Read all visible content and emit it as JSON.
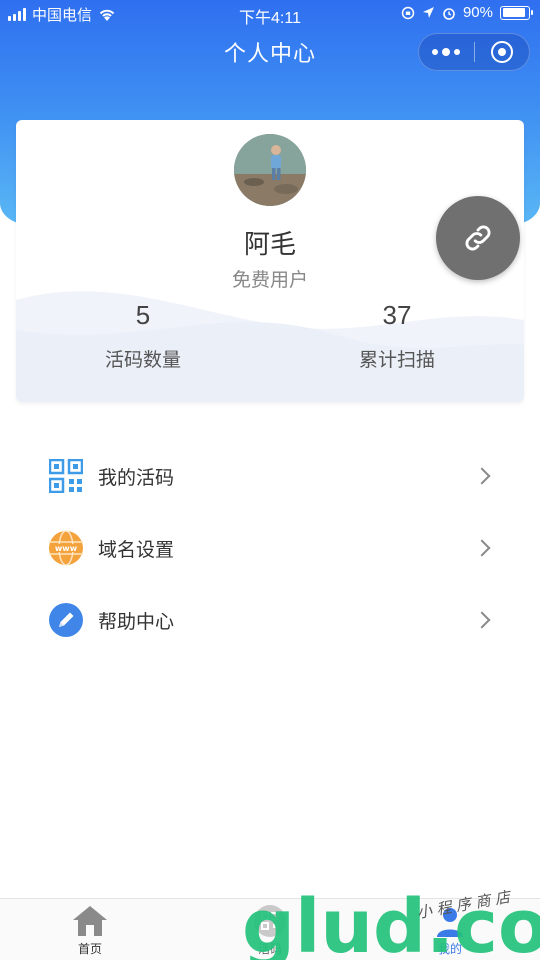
{
  "status_bar": {
    "carrier": "中国电信",
    "time": "下午4:11",
    "battery": "90%",
    "battery_level": 0.9
  },
  "nav": {
    "title": "个人中心"
  },
  "profile": {
    "name": "阿毛",
    "level": "免费用户",
    "stats": [
      {
        "value": "5",
        "label": "活码数量"
      },
      {
        "value": "37",
        "label": "累计扫描"
      }
    ]
  },
  "menu": [
    {
      "label": "我的活码",
      "icon": "qr-code-icon"
    },
    {
      "label": "域名设置",
      "icon": "globe-www-icon"
    },
    {
      "label": "帮助中心",
      "icon": "pencil-icon"
    }
  ],
  "tabbar": [
    {
      "label": "首页",
      "icon": "home-icon"
    },
    {
      "label": "活码",
      "icon": "qr-code-icon"
    },
    {
      "label": "我的",
      "icon": "user-icon"
    }
  ],
  "watermark": {
    "brand": "glud.com",
    "tagline": "小 程 序 商 店"
  },
  "colors": {
    "header_top": "#2f6ff0",
    "header_bottom": "#5ab7f5",
    "active_tab": "#3a7be8",
    "fab": "#707070"
  }
}
